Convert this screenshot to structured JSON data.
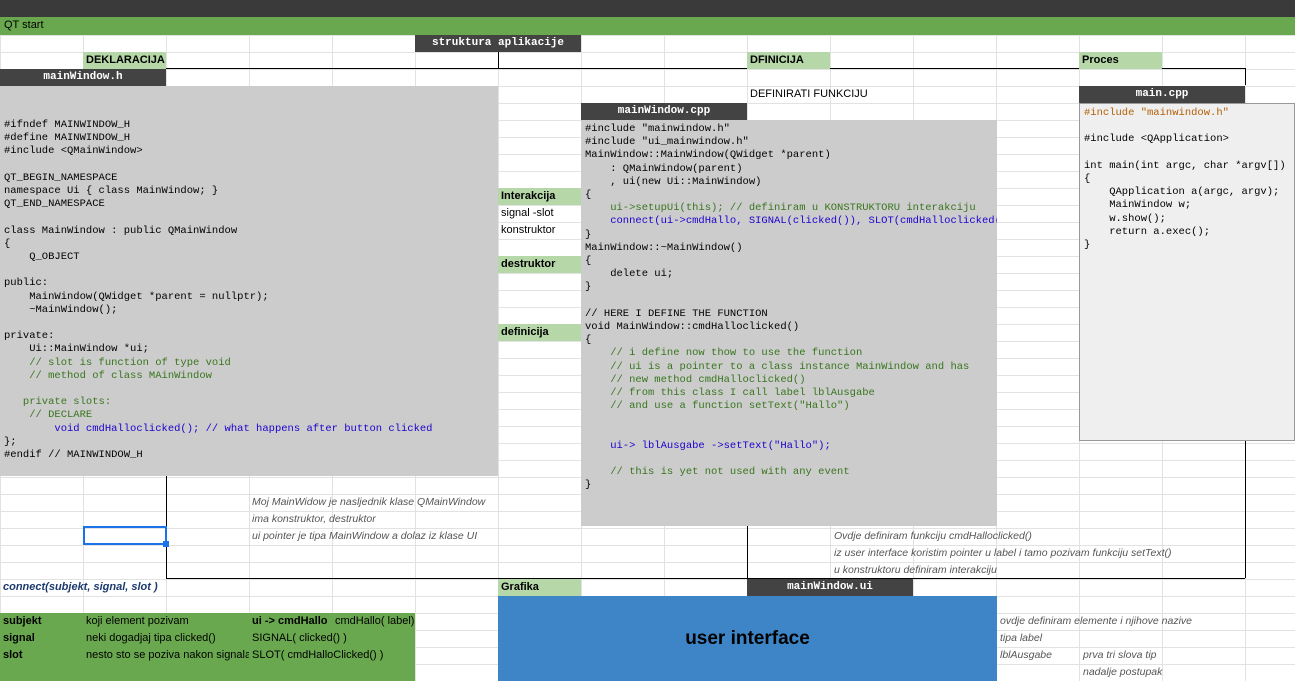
{
  "sheet": {
    "title": "QT start"
  },
  "headers": {
    "struktura": "struktura aplikacije",
    "deklaracija": "DEKLARACIJA",
    "dfinicija": "DFINICIJA",
    "proces": "Proces",
    "definirati": "DEFINIRATI FUNKCIJU"
  },
  "files": {
    "mainwindow_h": "mainWindow.h",
    "mainwindow_cpp": "mainWindow.cpp",
    "main_cpp": "main.cpp",
    "mainwindow_ui": "mainWindow.ui"
  },
  "labels": {
    "interakcija": "Interakcija",
    "signal_slot": "signal -slot",
    "konstruktor": "konstruktor",
    "destruktor": "destruktor",
    "definicija": "definicija",
    "grafika": "Grafika",
    "user_interface": "user interface"
  },
  "notes_h": [
    "Moj MainWidow je nasljednik klase QMainWindow",
    "ima konstruktor, destruktor",
    "ui pointer je tipa MainWindow a dolaz iz klase UI"
  ],
  "notes_cpp": [
    "Ovdje definiram funkciju cmdHalloclicked()",
    "iz user interface koristim pointer u label i tamo pozivam funkciju setText()",
    "u konstruktoru definiram interakciju"
  ],
  "notes_ui": [
    "ovdje definiram elemente i njihove nazive",
    "tipa label",
    "lblAusgabe",
    "prva tri slova tip",
    "nadalje postupak"
  ],
  "connect": {
    "title": "connect(subjekt, signal, slot )",
    "rows": [
      {
        "k": "subjekt",
        "v": "koji element pozivam",
        "a": "ui -> cmdHallo",
        "b": "cmdHallo( label)"
      },
      {
        "k": "signal",
        "v": "neki dogadjaj tipa clicked()",
        "a": "SIGNAL( clicked() )",
        "b": ""
      },
      {
        "k": "slot",
        "v": "nesto sto se poziva nakon signala",
        "a": "SLOT(  cmdHalloClicked()  )",
        "b": ""
      }
    ]
  },
  "code": {
    "h_lines": [
      "#ifndef MAINWINDOW_H",
      "#define MAINWINDOW_H",
      "#include <QMainWindow>",
      "",
      "QT_BEGIN_NAMESPACE",
      "namespace Ui { class MainWindow; }",
      "QT_END_NAMESPACE",
      "",
      "class MainWindow : public QMainWindow",
      "{",
      "    Q_OBJECT",
      "",
      "public:",
      "    MainWindow(QWidget *parent = nullptr);",
      "    ~MainWindow();",
      "",
      "private:",
      "    Ui::MainWindow *ui;",
      "    // slot is function of type void",
      "    // method of class MAinWindow",
      "",
      "   private slots:",
      "    // DECLARE",
      "        void cmdHalloclicked(); // what happens after button clicked",
      "};",
      "#endif // MAINWINDOW_H"
    ],
    "cpp_lines": [
      "#include \"mainwindow.h\"",
      "#include \"ui_mainwindow.h\"",
      "MainWindow::MainWindow(QWidget *parent)",
      "    : QMainWindow(parent)",
      "    , ui(new Ui::MainWindow)",
      "{",
      "    ui->setupUi(this); // definiram u KONSTRUKTORU interakciju",
      "    connect(ui->cmdHallo, SIGNAL(clicked()), SLOT(cmdHalloclicked()));",
      "}",
      "MainWindow::~MainWindow()",
      "{",
      "    delete ui;",
      "}",
      "",
      "// HERE I DEFINE THE FUNCTION",
      "void MainWindow::cmdHalloclicked()",
      "{",
      "    // i define now thow to use the function",
      "    // ui is a pointer to a class instance MainWindow and has",
      "    // new method cmdHalloclicked()",
      "    // from this class I call label lblAusgabe",
      "    // and use a function setText(\"Hallo\")",
      "",
      "",
      "    ui-> lblAusgabe ->setText(\"Hallo\");",
      "",
      "    // this is yet not used with any event",
      "}"
    ],
    "main_lines": [
      "#include \"mainwindow.h\"",
      "",
      "#include <QApplication>",
      "",
      "int main(int argc, char *argv[])",
      "{",
      "    QApplication a(argc, argv);",
      "    MainWindow w;",
      "    w.show();",
      "    return a.exec();",
      "}"
    ]
  },
  "colors": {
    "green_bar": "#6aa84f",
    "light_green": "#b6d7a8",
    "dark_header": "#434343",
    "code_bg": "#cccccc",
    "ui_blue": "#3d85c6"
  }
}
